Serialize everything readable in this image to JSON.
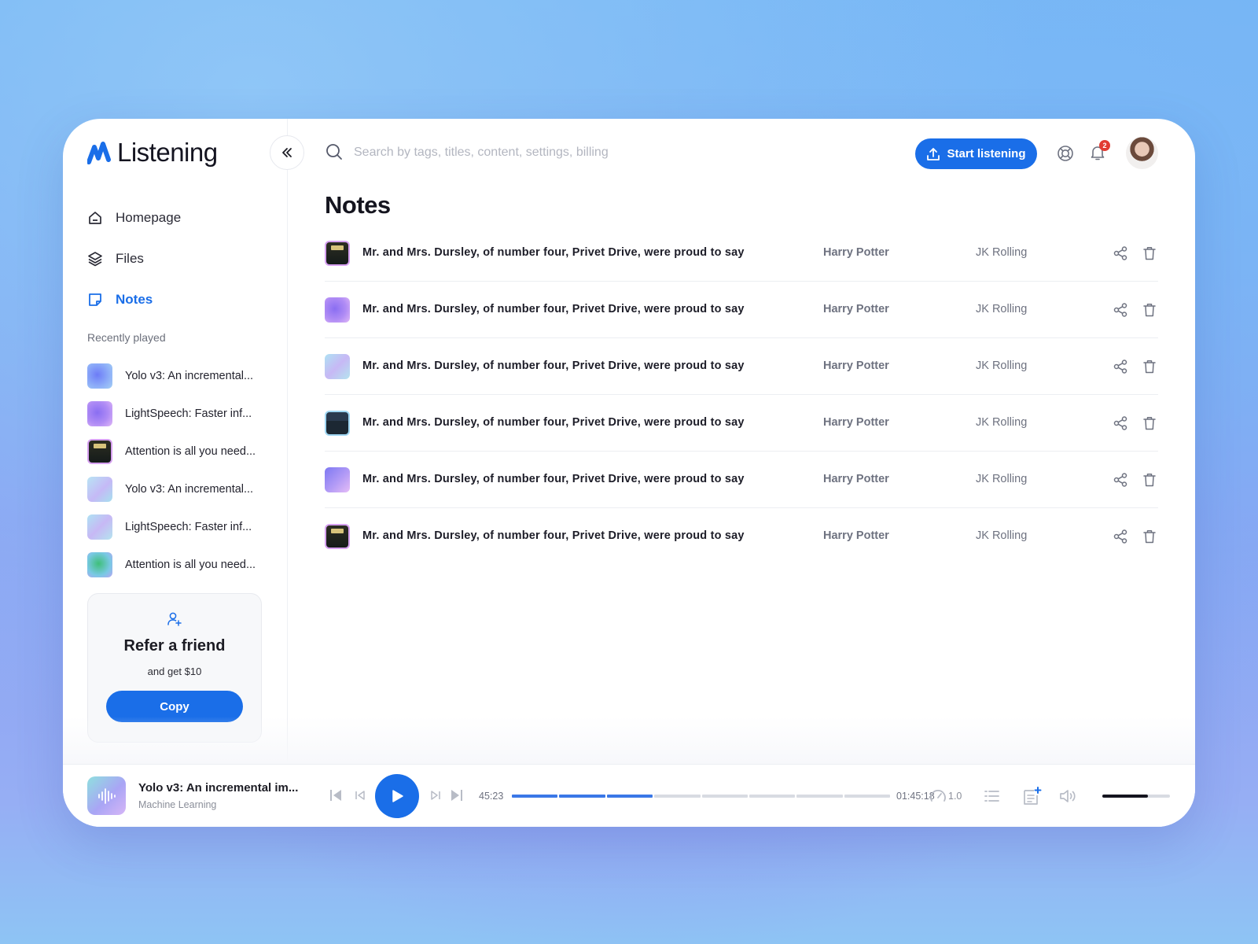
{
  "app": {
    "name": "Listening",
    "brand_color": "#1a6ee8"
  },
  "sidebar": {
    "nav": [
      {
        "label": "Homepage",
        "icon": "home-icon",
        "active": false
      },
      {
        "label": "Files",
        "icon": "layers-icon",
        "active": false
      },
      {
        "label": "Notes",
        "icon": "note-icon",
        "active": true
      }
    ],
    "recent_title": "Recently played",
    "recent": [
      {
        "label": "Yolo v3: An incremental...",
        "thumb": "gradient-blue"
      },
      {
        "label": "LightSpeech: Faster inf...",
        "thumb": "gradient-purple"
      },
      {
        "label": "Attention is all you need...",
        "thumb": "book-cover"
      },
      {
        "label": "Yolo v3: An incremental...",
        "thumb": "gradient-pastel"
      },
      {
        "label": "LightSpeech: Faster inf...",
        "thumb": "gradient-pastel"
      },
      {
        "label": "Attention is all you need...",
        "thumb": "gradient-green"
      }
    ],
    "refer": {
      "title": "Refer a friend",
      "subtitle": "and get $10",
      "button": "Copy"
    }
  },
  "header": {
    "search_placeholder": "Search by tags, titles, content, settings, billing",
    "start_button": "Start listening",
    "notifications_count": "2"
  },
  "page": {
    "title": "Notes"
  },
  "notes": [
    {
      "title": "Mr. and Mrs. Dursley, of number four, Privet Drive, were proud to say",
      "book": "Harry Potter",
      "author": "JK Rolling",
      "thumb": "book-cover"
    },
    {
      "title": "Mr. and Mrs. Dursley, of number four, Privet Drive, were proud to say",
      "book": "Harry Potter",
      "author": "JK Rolling",
      "thumb": "gradient-purple"
    },
    {
      "title": "Mr. and Mrs. Dursley, of number four, Privet Drive, were proud to say",
      "book": "Harry Potter",
      "author": "JK Rolling",
      "thumb": "gradient-pastel"
    },
    {
      "title": "Mr. and Mrs. Dursley, of number four, Privet Drive, were proud to say",
      "book": "Harry Potter",
      "author": "JK Rolling",
      "thumb": "book-cover-hobbit"
    },
    {
      "title": "Mr. and Mrs. Dursley, of number four, Privet Drive, were proud to say",
      "book": "Harry Potter",
      "author": "JK Rolling",
      "thumb": "gradient-purple"
    },
    {
      "title": "Mr. and Mrs. Dursley, of number four, Privet Drive, were proud to say",
      "book": "Harry Potter",
      "author": "JK Rolling",
      "thumb": "book-cover"
    }
  ],
  "player": {
    "title": "Yolo v3: An incremental im...",
    "subtitle": "Machine Learning",
    "elapsed": "45:23",
    "duration": "01:45:18",
    "progress_fraction": 0.32,
    "speed": "1.0",
    "volume_fraction": 0.68
  }
}
